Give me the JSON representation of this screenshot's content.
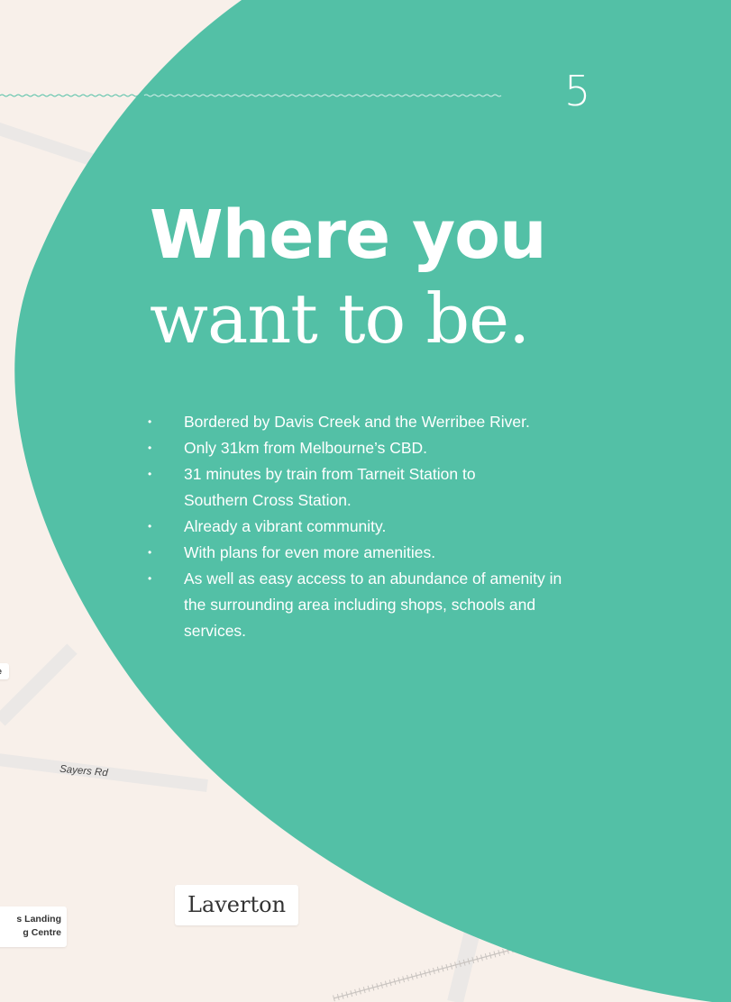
{
  "page_number": "5",
  "headline": {
    "line1": "Where you",
    "line2": "want to be."
  },
  "bullets": [
    "Bordered by Davis Creek and the Werribee River.",
    "Only 31km from Melbourne’s CBD.",
    "31 minutes by train from Tarneit Station to Southern Cross Station.",
    "Already a vibrant community.",
    "With plans for even more amenities.",
    "As well as easy access to an abundance of amenity in the surrounding area including shops, schools and services."
  ],
  "bullet_marker": "•",
  "map": {
    "label_centre": "entre",
    "label_landing": "s Landing\ng Centre",
    "road_name": "Sayers Rd",
    "place_name": "Laverton"
  },
  "colors": {
    "accent_teal": "#53c0a6",
    "map_background": "#f8f0ea",
    "road": "#ebe8e6",
    "text_on_accent": "#ffffff"
  }
}
